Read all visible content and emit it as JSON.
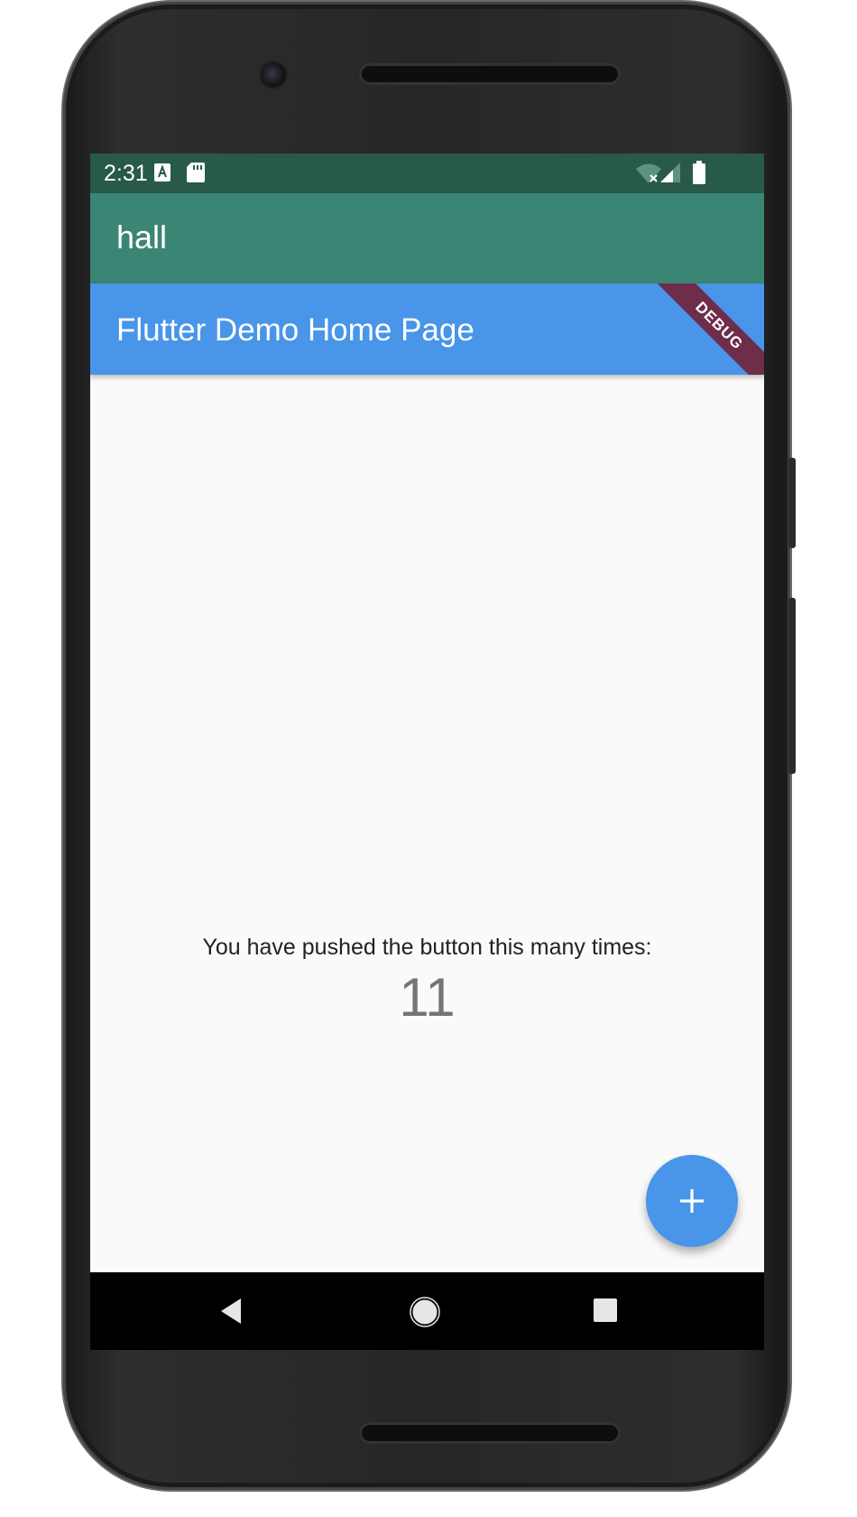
{
  "status_bar": {
    "time": "2:31",
    "left_icons": [
      "text-a-icon",
      "sd-card-icon"
    ],
    "right_icons": [
      "wifi-icon",
      "signal-icon",
      "battery-icon"
    ]
  },
  "primary_app_bar": {
    "title": "hall",
    "color": "#3b8574"
  },
  "secondary_app_bar": {
    "title": "Flutter Demo Home Page",
    "color": "#4895e9"
  },
  "debug_banner": {
    "label": "DEBUG"
  },
  "counter": {
    "label": "You have pushed the button this many times:",
    "value": "11"
  },
  "fab": {
    "icon": "plus-icon"
  },
  "nav_bar": {
    "buttons": [
      "back-icon",
      "home-icon",
      "recents-icon"
    ]
  }
}
